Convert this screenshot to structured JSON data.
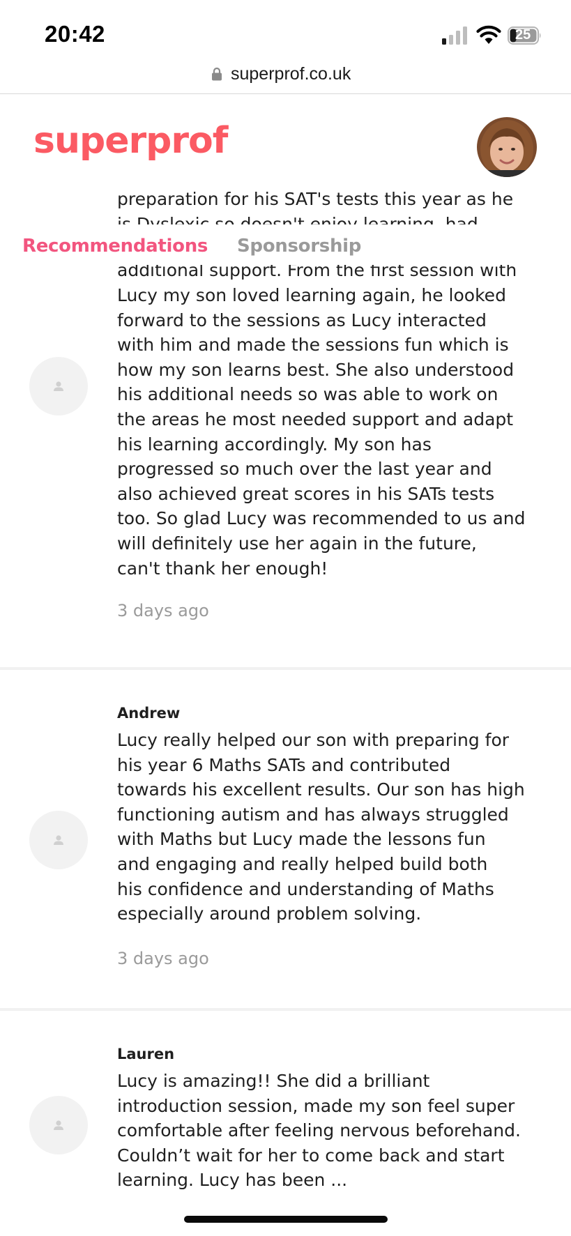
{
  "status_bar": {
    "time": "20:42",
    "battery": "25"
  },
  "browser": {
    "url": "superprof.co.uk"
  },
  "header": {
    "logo": "superprof"
  },
  "tabs": {
    "recommendations": "Recommendations",
    "sponsorship": "Sponsorship"
  },
  "clipped_above": {
    "line1": "preparation for his SAT's tests this year as he",
    "line2": "is Dyslexic so doesn't enjoy learning, had",
    "line3": "additional support. From the first session with"
  },
  "reviews": [
    {
      "text": "Lucy my son loved learning again, he looked\nforward to the sessions as Lucy interacted\nwith him and made the sessions fun which is\nhow my son learns best. She also understood\nhis additional needs so was able to work on\nthe areas he most needed support and adapt\nhis learning accordingly. My son has\nprogressed so much over the last year and\nalso achieved great scores in his SATs tests\ntoo. So glad Lucy was recommended to us and\nwill definitely use her again in the future,\ncan't thank her enough!",
      "time": "3 days ago"
    },
    {
      "author": "Andrew",
      "text": "Lucy really helped our son with preparing for\nhis year 6 Maths SATs and contributed\ntowards his excellent results. Our son has high\nfunctioning autism and has always struggled\nwith Maths but Lucy made the lessons fun\nand engaging and really helped build both\nhis confidence and understanding of Maths\nespecially around problem solving.",
      "time": "3 days ago"
    },
    {
      "author": "Lauren",
      "text": "Lucy is amazing!! She did a brilliant\nintroduction session, made my son feel super\ncomfortable after feeling nervous beforehand.\nCouldn’t wait for her to come back and start\nlearning. Lucy has been ..."
    }
  ]
}
